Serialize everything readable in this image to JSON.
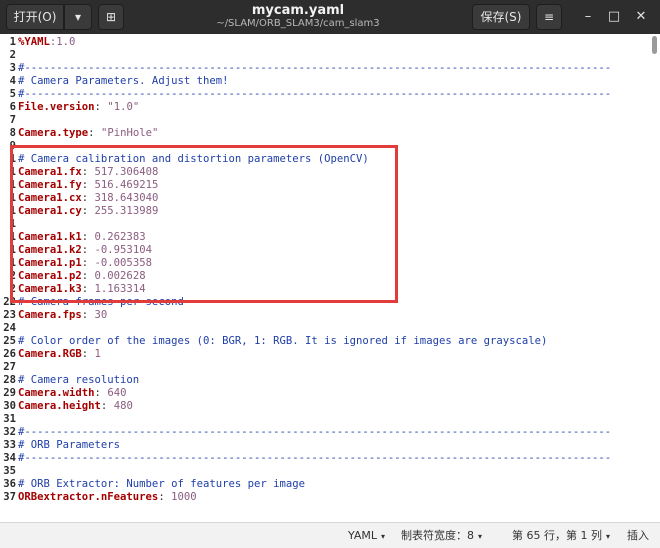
{
  "header": {
    "open_label": "打开(O)",
    "open_dropdown_glyph": "▾",
    "new_tab_glyph": "⊞",
    "title": "mycam.yaml",
    "subtitle": "~/SLAM/ORB_SLAM3/cam_slam3",
    "save_label": "保存(S)",
    "menu_glyph": "≡",
    "minimize_glyph": "–",
    "maximize_glyph": "□",
    "close_glyph": "✕"
  },
  "editor": {
    "lines": [
      {
        "n": "1",
        "parts": [
          {
            "t": "%YAML",
            "c": "t-key"
          },
          {
            "t": ":1.0",
            "c": "t-val"
          }
        ]
      },
      {
        "n": "2",
        "parts": []
      },
      {
        "n": "3",
        "parts": [
          {
            "t": "#--------------------------------------------------------------------------------------------",
            "c": "t-comment"
          }
        ]
      },
      {
        "n": "4",
        "parts": [
          {
            "t": "# Camera Parameters. Adjust them!",
            "c": "t-comment"
          }
        ]
      },
      {
        "n": "5",
        "parts": [
          {
            "t": "#--------------------------------------------------------------------------------------------",
            "c": "t-comment"
          }
        ]
      },
      {
        "n": "6",
        "parts": [
          {
            "t": "File.version",
            "c": "t-key"
          },
          {
            "t": ": ",
            "c": "t-plain"
          },
          {
            "t": "\"1.0\"",
            "c": "t-str"
          }
        ]
      },
      {
        "n": "7",
        "parts": []
      },
      {
        "n": "8",
        "parts": [
          {
            "t": "Camera.type",
            "c": "t-key"
          },
          {
            "t": ": ",
            "c": "t-plain"
          },
          {
            "t": "\"PinHole\"",
            "c": "t-str"
          }
        ]
      },
      {
        "n": "9",
        "parts": []
      },
      {
        "n": "1",
        "parts": [
          {
            "t": "# Camera calibration and distortion parameters (OpenCV)",
            "c": "t-comment"
          }
        ]
      },
      {
        "n": "1",
        "parts": [
          {
            "t": "Camera1.fx",
            "c": "t-key"
          },
          {
            "t": ": ",
            "c": "t-plain"
          },
          {
            "t": "517.306408",
            "c": "t-val"
          }
        ]
      },
      {
        "n": "1",
        "parts": [
          {
            "t": "Camera1.fy",
            "c": "t-key"
          },
          {
            "t": ": ",
            "c": "t-plain"
          },
          {
            "t": "516.469215",
            "c": "t-val"
          }
        ]
      },
      {
        "n": "1",
        "parts": [
          {
            "t": "Camera1.cx",
            "c": "t-key"
          },
          {
            "t": ": ",
            "c": "t-plain"
          },
          {
            "t": "318.643040",
            "c": "t-val"
          }
        ]
      },
      {
        "n": "1",
        "parts": [
          {
            "t": "Camera1.cy",
            "c": "t-key"
          },
          {
            "t": ": ",
            "c": "t-plain"
          },
          {
            "t": "255.313989",
            "c": "t-val"
          }
        ]
      },
      {
        "n": "1",
        "parts": []
      },
      {
        "n": "1",
        "parts": [
          {
            "t": "Camera1.k1",
            "c": "t-key"
          },
          {
            "t": ": ",
            "c": "t-plain"
          },
          {
            "t": "0.262383",
            "c": "t-val"
          }
        ]
      },
      {
        "n": "1",
        "parts": [
          {
            "t": "Camera1.k2",
            "c": "t-key"
          },
          {
            "t": ": ",
            "c": "t-plain"
          },
          {
            "t": "-0.953104",
            "c": "t-val"
          }
        ]
      },
      {
        "n": "1",
        "parts": [
          {
            "t": "Camera1.p1",
            "c": "t-key"
          },
          {
            "t": ": ",
            "c": "t-plain"
          },
          {
            "t": "-0.005358",
            "c": "t-val"
          }
        ]
      },
      {
        "n": "2",
        "parts": [
          {
            "t": "Camera1.p2",
            "c": "t-key"
          },
          {
            "t": ": ",
            "c": "t-plain"
          },
          {
            "t": "0.002628",
            "c": "t-val"
          }
        ]
      },
      {
        "n": "2",
        "parts": [
          {
            "t": "Camera1.k3",
            "c": "t-key"
          },
          {
            "t": ": ",
            "c": "t-plain"
          },
          {
            "t": "1.163314",
            "c": "t-val"
          }
        ]
      },
      {
        "n": "22",
        "parts": [
          {
            "t": "# Camera frames per second",
            "c": "t-comment"
          }
        ]
      },
      {
        "n": "23",
        "parts": [
          {
            "t": "Camera.fps",
            "c": "t-key"
          },
          {
            "t": ": ",
            "c": "t-plain"
          },
          {
            "t": "30",
            "c": "t-val"
          }
        ]
      },
      {
        "n": "24",
        "parts": []
      },
      {
        "n": "25",
        "parts": [
          {
            "t": "# Color order of the images (0: BGR, 1: RGB. It is ignored if images are grayscale)",
            "c": "t-comment"
          }
        ]
      },
      {
        "n": "26",
        "parts": [
          {
            "t": "Camera.RGB",
            "c": "t-key"
          },
          {
            "t": ": ",
            "c": "t-plain"
          },
          {
            "t": "1",
            "c": "t-val"
          }
        ]
      },
      {
        "n": "27",
        "parts": []
      },
      {
        "n": "28",
        "parts": [
          {
            "t": "# Camera resolution",
            "c": "t-comment"
          }
        ]
      },
      {
        "n": "29",
        "parts": [
          {
            "t": "Camera.width",
            "c": "t-key"
          },
          {
            "t": ": ",
            "c": "t-plain"
          },
          {
            "t": "640",
            "c": "t-val"
          }
        ]
      },
      {
        "n": "30",
        "parts": [
          {
            "t": "Camera.height",
            "c": "t-key"
          },
          {
            "t": ": ",
            "c": "t-plain"
          },
          {
            "t": "480",
            "c": "t-val"
          }
        ]
      },
      {
        "n": "31",
        "parts": []
      },
      {
        "n": "32",
        "parts": [
          {
            "t": "#--------------------------------------------------------------------------------------------",
            "c": "t-comment"
          }
        ]
      },
      {
        "n": "33",
        "parts": [
          {
            "t": "# ORB Parameters",
            "c": "t-comment"
          }
        ]
      },
      {
        "n": "34",
        "parts": [
          {
            "t": "#--------------------------------------------------------------------------------------------",
            "c": "t-comment"
          }
        ]
      },
      {
        "n": "35",
        "parts": []
      },
      {
        "n": "36",
        "parts": [
          {
            "t": "# ORB Extractor: Number of features per image",
            "c": "t-comment"
          }
        ]
      },
      {
        "n": "37",
        "parts": [
          {
            "t": "ORBextractor.nFeatures",
            "c": "t-key"
          },
          {
            "t": ": ",
            "c": "t-plain"
          },
          {
            "t": "1000",
            "c": "t-val"
          }
        ]
      }
    ]
  },
  "statusbar": {
    "language": "YAML",
    "tab_width": "制表符宽度：8",
    "position": "第 65 行，第 1 列",
    "mode": "插入",
    "dropdown_glyph": "▾"
  },
  "colors": {
    "highlight_box": "#e23b3b",
    "comment": "#1f3fa8",
    "key": "#a40000",
    "value": "#8a5c80"
  }
}
